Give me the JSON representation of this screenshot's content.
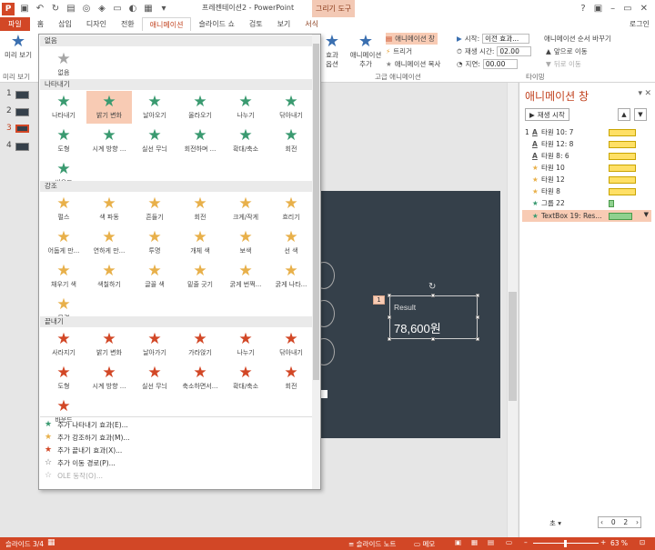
{
  "title_bar": {
    "doc_title": "프레젠테이션2 - PowerPoint",
    "context_group": "그리기 도구"
  },
  "tabs": [
    {
      "label": "파일"
    },
    {
      "label": "홈"
    },
    {
      "label": "삽입"
    },
    {
      "label": "디자인"
    },
    {
      "label": "전환"
    },
    {
      "label": "애니메이션"
    },
    {
      "label": "슬라이드 쇼"
    },
    {
      "label": "검토"
    },
    {
      "label": "보기"
    },
    {
      "label": "서식"
    }
  ],
  "sign_in": "로그인",
  "ribbon": {
    "preview_label": "미리 보기",
    "preview_group": "미리 보기",
    "effect_options": "효과 옵션",
    "add_animation": "애니메이션 추가",
    "animation_pane": "애니메이션 창",
    "trigger": "트리거",
    "painter": "애니메이션 복사",
    "adv_group": "고급 애니메이션",
    "start_label": "시작:",
    "start_value": "이전 효과...",
    "duration_label": "재생 시간:",
    "duration_value": "02.00",
    "delay_label": "지연:",
    "delay_value": "00.00",
    "reorder_title": "애니메이션 순서 바꾸기",
    "move_earlier": "앞으로 이동",
    "move_later": "뒤로 이동",
    "timing_group": "타이밍"
  },
  "thumbnails": [
    "1",
    "2",
    "3",
    "4"
  ],
  "gallery": {
    "none_header": "없음",
    "none_item": "없음",
    "entrance_header": "나타내기",
    "entrance": [
      "나타내기",
      "밝기 변화",
      "날아오기",
      "올라오기",
      "나누기",
      "닦아내기",
      "도형",
      "시계 방향 ...",
      "실선 무늬",
      "회전하며 ...",
      "확대/축소",
      "회전",
      "바운드"
    ],
    "emphasis_header": "강조",
    "emphasis": [
      "펄스",
      "색 파동",
      "흔들기",
      "회전",
      "크게/작게",
      "흐리기",
      "어둡게 만...",
      "연하게 만...",
      "투명",
      "개체 색",
      "보색",
      "선 색",
      "채우기 색",
      "색칠하기",
      "글꼴 색",
      "밑줄 긋기",
      "굵게 번쩍...",
      "굵게 나타...",
      "물결"
    ],
    "exit_header": "끝내기",
    "exit": [
      "사라지기",
      "밝기 변화",
      "날아가기",
      "가라앉기",
      "나누기",
      "닦아내기",
      "도형",
      "시계 방향 ...",
      "실선 무늬",
      "축소하면서...",
      "확대/축소",
      "회전",
      "바운드"
    ],
    "more": [
      "추가 나타내기 효과(E)...",
      "추가 강조하기 효과(M)...",
      "추가 끝내기 효과(X)...",
      "추가 이동 경로(P)...",
      "OLE 동작(O)..."
    ]
  },
  "slide": {
    "result_label": "Result",
    "result_value": "78,600원",
    "anim_tag": "1"
  },
  "pane": {
    "title": "애니메이션 창",
    "play_button": "재생 시작",
    "items": [
      {
        "num": "1",
        "label": "타원 10: 7"
      },
      {
        "num": "",
        "label": "타원 12: 8"
      },
      {
        "num": "",
        "label": "타원 8: 6"
      },
      {
        "num": "",
        "label": "타원 10"
      },
      {
        "num": "",
        "label": "타원 12"
      },
      {
        "num": "",
        "label": "타원 8"
      },
      {
        "num": "",
        "label": "그룹 22"
      },
      {
        "num": "",
        "label": "TextBox 19: Res..."
      }
    ],
    "seconds_label": "초",
    "page_from": "0",
    "page_to": "2"
  },
  "status": {
    "slide_info": "슬라이드 3/4",
    "notes": "슬라이드 노트",
    "comments": "메모",
    "zoom": "63 %"
  },
  "colors": {
    "accent": "#d24726",
    "entrance": "#3a9a70",
    "emphasis": "#e8b04a",
    "exit": "#d24726",
    "slide_bg": "#35404a"
  }
}
